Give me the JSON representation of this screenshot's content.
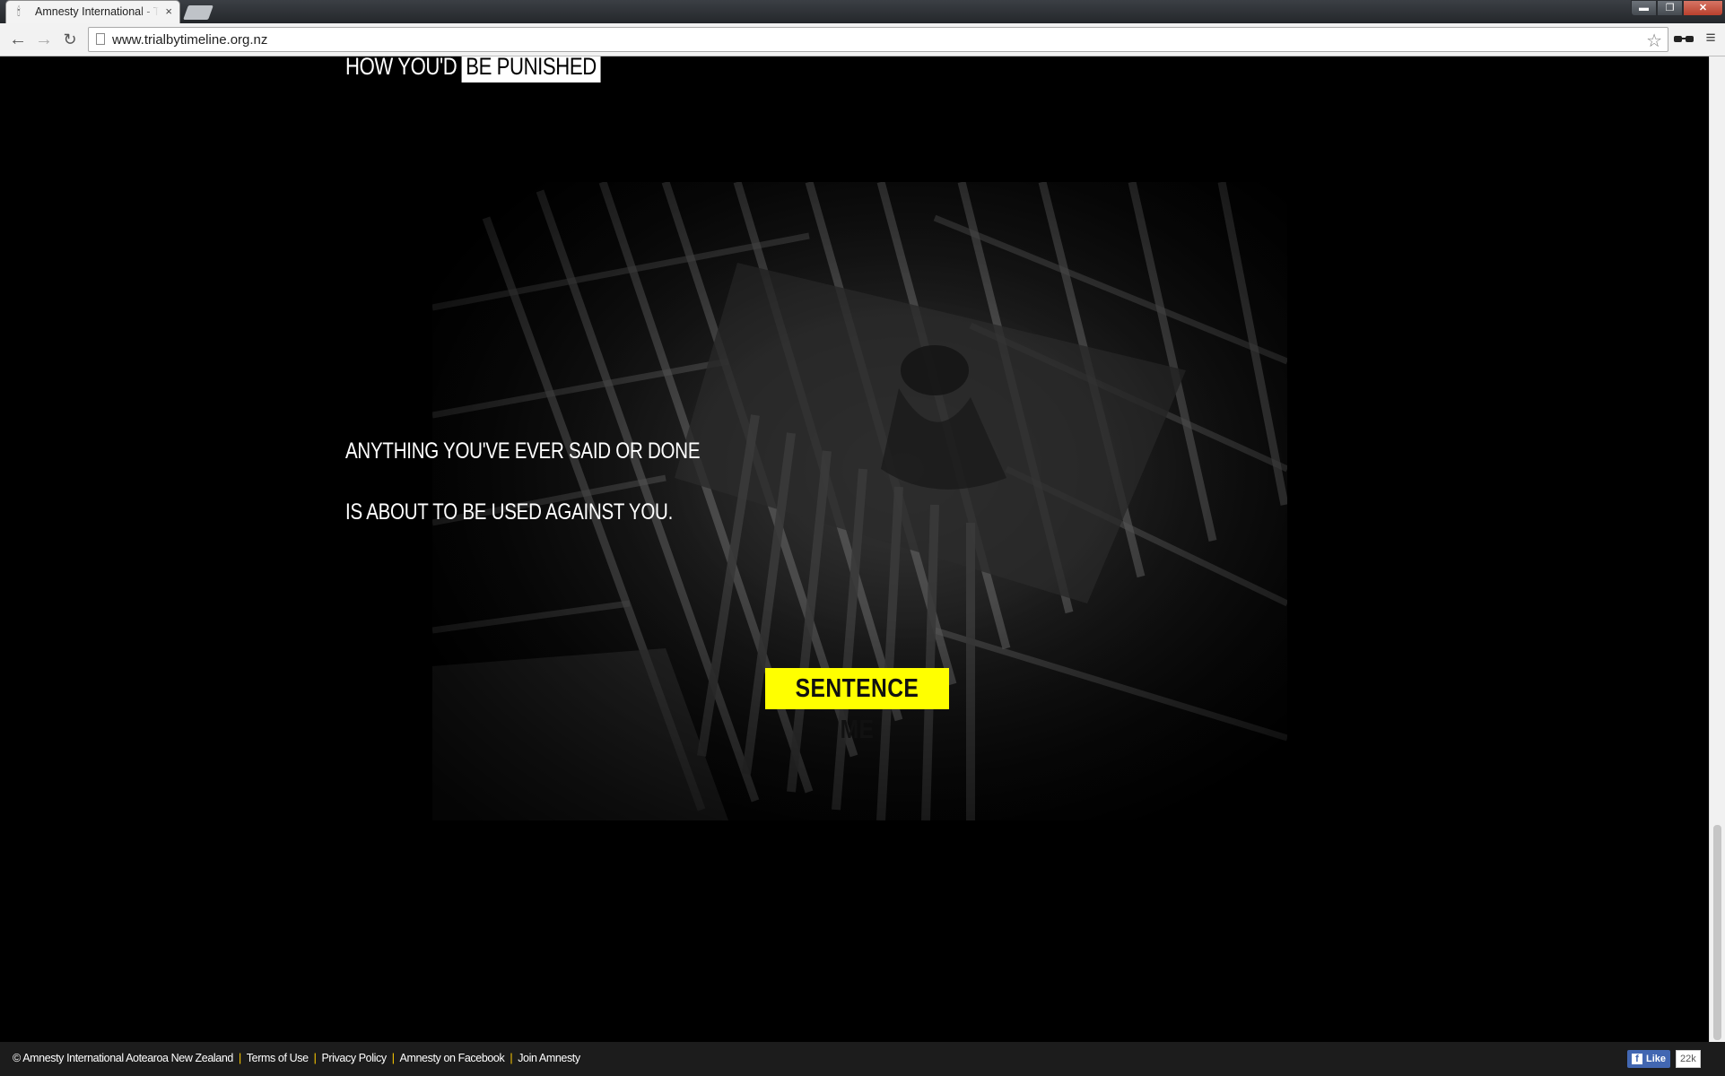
{
  "browser": {
    "tab_title": "Amnesty International - Trial by Timeline",
    "tab_favicon": "candle-icon",
    "tab_close": "×",
    "url": "www.trialbytimeline.org.nz",
    "window_controls": {
      "minimize": "▬",
      "maximize": "❐",
      "close": "✕"
    }
  },
  "page": {
    "heading": {
      "plain": "HOW YOU'D",
      "highlight": "BE PUNISHED"
    },
    "message_line_1": "ANYTHING YOU'VE EVER SAID OR DONE",
    "message_line_2": "IS ABOUT TO BE USED AGAINST YOU.",
    "cta_label": "SENTENCE ME",
    "image_subject": "prison-cell-photo"
  },
  "footer": {
    "copyright": "© Amnesty International Aotearoa New Zealand",
    "links": [
      "Terms of Use",
      "Privacy Policy",
      "Amnesty on Facebook",
      "Join Amnesty"
    ],
    "separator": "|",
    "fb_like_label": "Like",
    "fb_like_count": "22k"
  },
  "colors": {
    "background": "#000000",
    "cta_background": "#ffff00",
    "footer_background": "#1c1c1c",
    "footer_separator": "#ffcc00"
  }
}
